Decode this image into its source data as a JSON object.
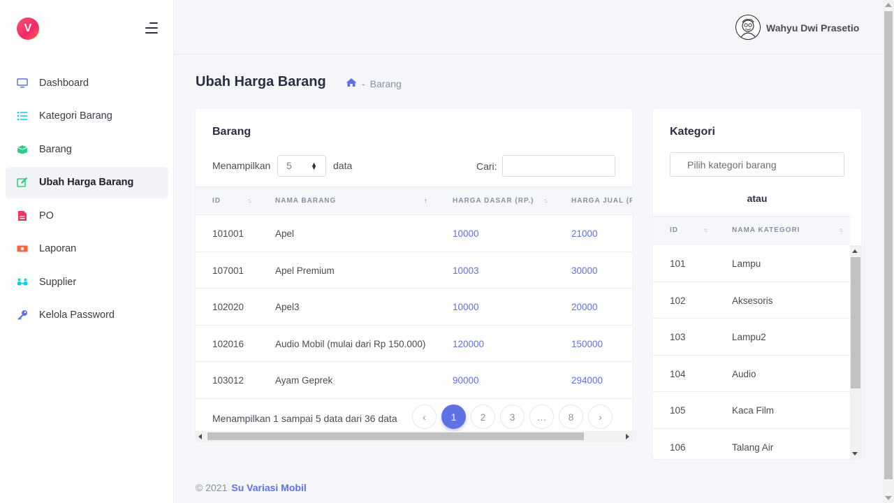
{
  "brand": {
    "logo_letter": "V"
  },
  "sidebar": {
    "items": [
      {
        "label": "Dashboard",
        "icon": "monitor-icon",
        "color": "#5e72e4"
      },
      {
        "label": "Kategori Barang",
        "icon": "list-icon",
        "color": "#11cdef"
      },
      {
        "label": "Barang",
        "icon": "box-icon",
        "color": "#2dce89"
      },
      {
        "label": "Ubah Harga Barang",
        "icon": "edit-icon",
        "color": "#2dce89",
        "active": true
      },
      {
        "label": "PO",
        "icon": "document-icon",
        "color": "#f5365c"
      },
      {
        "label": "Laporan",
        "icon": "money-icon",
        "color": "#fb6340"
      },
      {
        "label": "Supplier",
        "icon": "users-icon",
        "color": "#11cdef"
      },
      {
        "label": "Kelola Password",
        "icon": "key-icon",
        "color": "#5e72e4"
      }
    ]
  },
  "topbar": {
    "user_name": "Wahyu Dwi Prasetio"
  },
  "page": {
    "title": "Ubah Harga Barang",
    "breadcrumb": {
      "separator": "-",
      "current": "Barang"
    }
  },
  "barang": {
    "title": "Barang",
    "length_label": "Menampilkan",
    "length_value": "5",
    "length_after": "data",
    "search_label": "Cari:",
    "columns": [
      "ID",
      "NAMA BARANG",
      "HARGA DASAR (RP.)",
      "HARGA JUAL (R"
    ],
    "rows": [
      {
        "id": "101001",
        "nama": "Apel",
        "harga_dasar": "10000",
        "harga_jual": "21000"
      },
      {
        "id": "107001",
        "nama": "Apel Premium",
        "harga_dasar": "10003",
        "harga_jual": "30000"
      },
      {
        "id": "102020",
        "nama": "Apel3",
        "harga_dasar": "10000",
        "harga_jual": "20000"
      },
      {
        "id": "102016",
        "nama": "Audio Mobil (mulai dari Rp 150.000)",
        "harga_dasar": "120000",
        "harga_jual": "150000"
      },
      {
        "id": "103012",
        "nama": "Ayam Geprek",
        "harga_dasar": "90000",
        "harga_jual": "294000"
      }
    ],
    "info": "Menampilkan 1 sampai 5 data dari 36 data",
    "pagination": [
      "‹",
      "1",
      "2",
      "3",
      "…",
      "8",
      "›"
    ],
    "active_page": "1"
  },
  "kategori": {
    "title": "Kategori",
    "select_placeholder": "Pilih kategori barang",
    "or_label": "atau",
    "columns": [
      "ID",
      "NAMA KATEGORI"
    ],
    "rows": [
      {
        "id": "101",
        "nama": "Lampu"
      },
      {
        "id": "102",
        "nama": "Aksesoris"
      },
      {
        "id": "103",
        "nama": "Lampu2"
      },
      {
        "id": "104",
        "nama": "Audio"
      },
      {
        "id": "105",
        "nama": "Kaca Film"
      },
      {
        "id": "106",
        "nama": "Talang Air"
      }
    ]
  },
  "footer": {
    "copyright": "© 2021",
    "brand": "Su Variasi Mobil"
  }
}
